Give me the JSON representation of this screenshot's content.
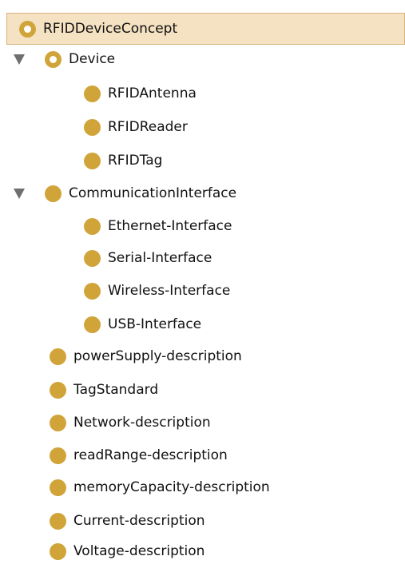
{
  "tree": {
    "root": {
      "label": "RFIDDeviceConcept",
      "icon": "anchor-class-icon"
    },
    "device": {
      "label": "Device",
      "icon": "anchor-class-icon",
      "toggle_icon": "expanded-triangle-icon",
      "children": [
        {
          "label": "RFIDAntenna",
          "icon": "class-icon"
        },
        {
          "label": "RFIDReader",
          "icon": "class-icon"
        },
        {
          "label": "RFIDTag",
          "icon": "class-icon"
        }
      ]
    },
    "communication": {
      "label": "CommunicationInterface",
      "icon": "class-icon",
      "toggle_icon": "expanded-triangle-icon",
      "children": [
        {
          "label": "Ethernet-Interface",
          "icon": "class-icon"
        },
        {
          "label": "Serial-Interface",
          "icon": "class-icon"
        },
        {
          "label": "Wireless-Interface",
          "icon": "class-icon"
        },
        {
          "label": "USB-Interface",
          "icon": "class-icon"
        }
      ]
    },
    "others": [
      {
        "label": "powerSupply-description",
        "icon": "class-icon"
      },
      {
        "label": "TagStandard",
        "icon": "class-icon"
      },
      {
        "label": "Network-description",
        "icon": "class-icon"
      },
      {
        "label": "readRange-description",
        "icon": "class-icon"
      },
      {
        "label": "memoryCapacity-description",
        "icon": "class-icon"
      },
      {
        "label": "Current-description",
        "icon": "class-icon"
      },
      {
        "label": "Voltage-description",
        "icon": "class-icon"
      }
    ],
    "colors": {
      "class_dot": "#d1a43a",
      "selected_background": "#f5e2c2",
      "selected_border": "#d7b27c",
      "toggle": "#6f6f6f"
    }
  }
}
